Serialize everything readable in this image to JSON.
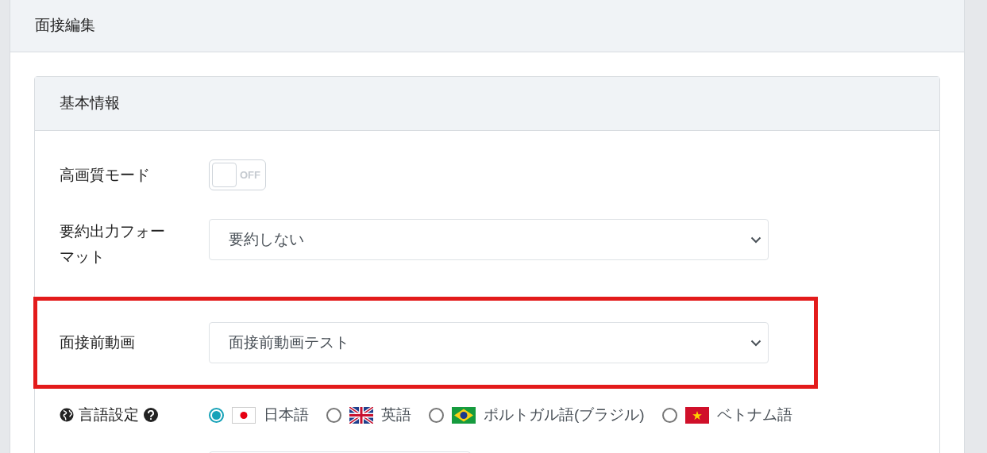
{
  "page_title": "面接編集",
  "section": {
    "title": "基本情報",
    "rows": [
      {
        "kind": "toggle",
        "label": "高画質モード",
        "on": false,
        "toggle_text": "OFF",
        "highlighted": false
      },
      {
        "kind": "select",
        "label": "要約出力フォーマット",
        "value": "要約しない",
        "highlighted": false
      },
      {
        "kind": "select",
        "label": "面接前動画",
        "value": "面接前動画テスト",
        "highlighted": true
      },
      {
        "kind": "radio",
        "label": "言語設定",
        "highlighted": false,
        "options": [
          {
            "label": "日本語",
            "kind": "jp",
            "selected": true
          },
          {
            "label": "英語",
            "kind": "gb",
            "selected": false
          },
          {
            "label": "ポルトガル語(ブラジル)",
            "kind": "br",
            "selected": false
          },
          {
            "label": "ベトナム語",
            "kind": "vn",
            "selected": false
          }
        ]
      },
      {
        "kind": "input",
        "highlighted": false
      }
    ]
  }
}
